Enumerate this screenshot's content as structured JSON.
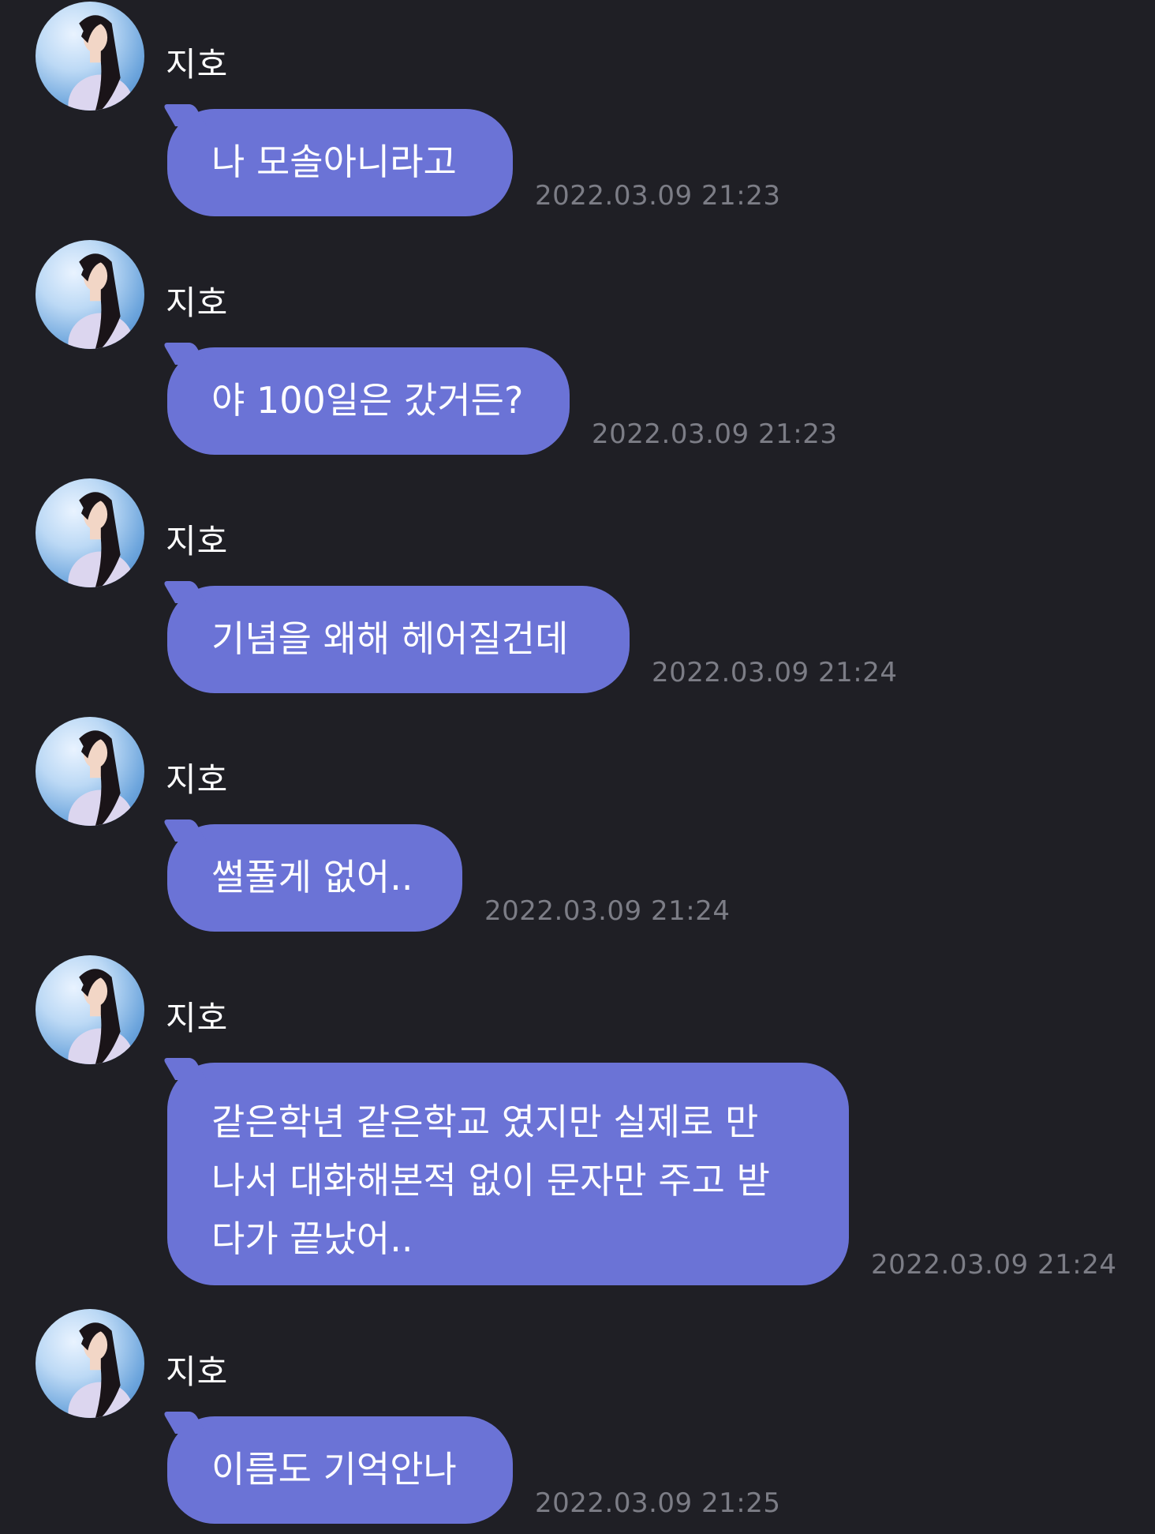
{
  "colors": {
    "background": "#1f1f25",
    "bubble": "#6b73d6",
    "sender_text": "#ffffff",
    "timestamp_text": "#7c7d86"
  },
  "messages": [
    {
      "sender": "지호",
      "text": "나 모솔아니라고",
      "time": "2022.03.09 21:23"
    },
    {
      "sender": "지호",
      "text": "야 100일은 갔거든?",
      "time": "2022.03.09 21:23"
    },
    {
      "sender": "지호",
      "text": "기념을 왜해 헤어질건데",
      "time": "2022.03.09 21:24"
    },
    {
      "sender": "지호",
      "text": "썰풀게 없어..",
      "time": "2022.03.09 21:24"
    },
    {
      "sender": "지호",
      "text": "같은학년 같은학교 였지만 실제로 만\n나서 대화해본적 없이 문자만 주고 받\n다가 끝났어..",
      "time": "2022.03.09 21:24"
    },
    {
      "sender": "지호",
      "text": "이름도 기억안나",
      "time": "2022.03.09 21:25"
    }
  ]
}
